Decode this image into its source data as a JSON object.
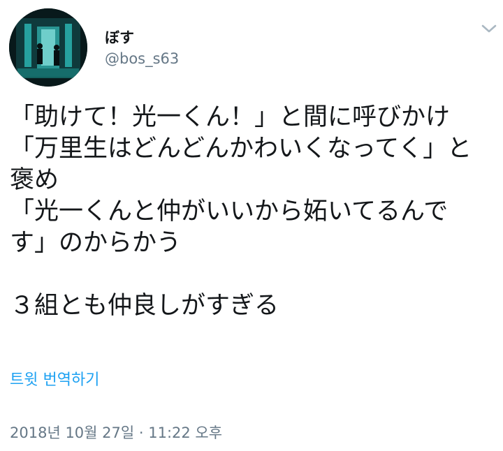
{
  "user": {
    "display_name": "ぼす",
    "handle": "@bos_s63",
    "avatar_icon": "avatar-image"
  },
  "menu": {
    "icon": "chevron-down-icon"
  },
  "tweet": {
    "lines": [
      "「助けて！光一くん！」と間に呼びかけ",
      "「万里生はどんどんかわいくなってく」と",
      "褒め",
      "「光一くんと仲がいいから妬いてるんで",
      "す」のからかう",
      "",
      "３組とも仲良しがすぎる"
    ]
  },
  "translate_label": "트윗 번역하기",
  "timestamp": "2018년 10월 27일 · 11:22 오후",
  "colors": {
    "text": "#14171a",
    "muted": "#657786",
    "link": "#1da1f2"
  }
}
